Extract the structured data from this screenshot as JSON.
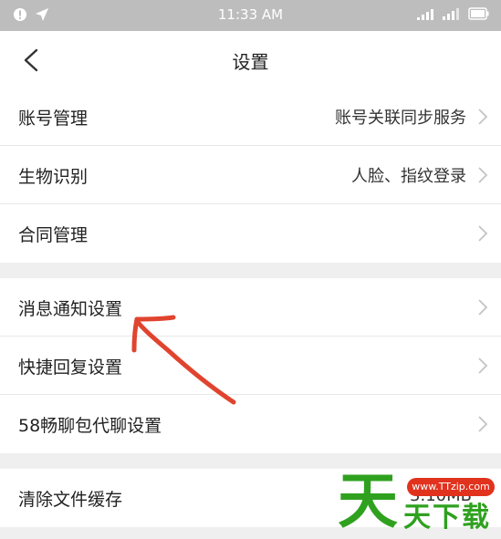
{
  "status_bar": {
    "time": "11:33 AM"
  },
  "nav": {
    "title": "设置"
  },
  "groups": [
    {
      "rows": [
        {
          "label": "账号管理",
          "value": "账号关联同步服务"
        },
        {
          "label": "生物识别",
          "value": "人脸、指纹登录"
        },
        {
          "label": "合同管理",
          "value": ""
        }
      ]
    },
    {
      "rows": [
        {
          "label": "消息通知设置",
          "value": ""
        },
        {
          "label": "快捷回复设置",
          "value": ""
        },
        {
          "label": "58畅聊包代聊设置",
          "value": ""
        }
      ]
    },
    {
      "rows": [
        {
          "label": "清除文件缓存",
          "value": "3.10MB"
        }
      ]
    }
  ],
  "watermark": {
    "url": "www.TTzip.com",
    "big_char": "天",
    "text": "天下载"
  },
  "colors": {
    "status_bar": "#bdbdbd",
    "page_background": "#efefef",
    "annotation_arrow": "#e0442f",
    "watermark_green": "#2fa11f",
    "watermark_red": "#e1321e"
  }
}
